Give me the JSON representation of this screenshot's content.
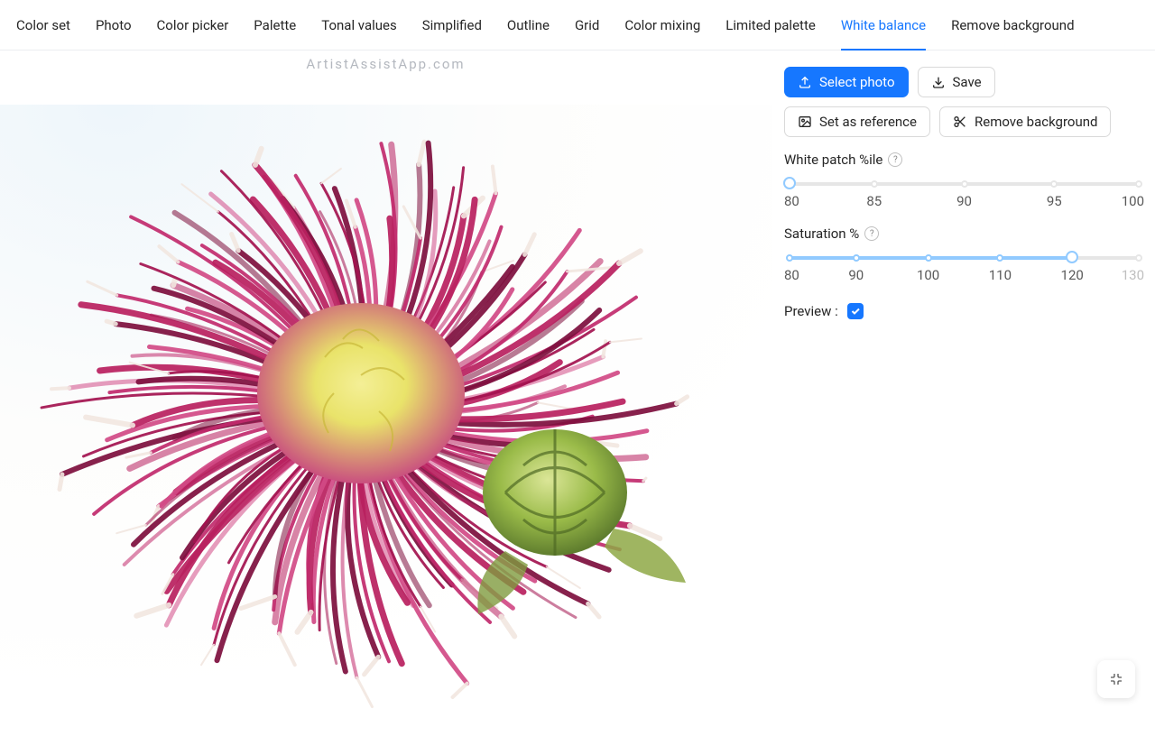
{
  "tabs": {
    "items": [
      {
        "label": "Color set"
      },
      {
        "label": "Photo"
      },
      {
        "label": "Color picker"
      },
      {
        "label": "Palette"
      },
      {
        "label": "Tonal values"
      },
      {
        "label": "Simplified"
      },
      {
        "label": "Outline"
      },
      {
        "label": "Grid"
      },
      {
        "label": "Color mixing"
      },
      {
        "label": "Limited palette"
      },
      {
        "label": "White balance"
      },
      {
        "label": "Remove background"
      }
    ],
    "activeIndex": 10
  },
  "watermark": "ArtistAssistApp.com",
  "buttons": {
    "selectPhoto": "Select photo",
    "save": "Save",
    "setRef": "Set as reference",
    "removeBg": "Remove background"
  },
  "whitePatch": {
    "label": "White patch %ile",
    "min": 80,
    "max": 100,
    "value": 80,
    "marks": [
      "80",
      "85",
      "90",
      "95",
      "100"
    ]
  },
  "saturation": {
    "label": "Saturation %",
    "min": 80,
    "max": 130,
    "value": 120,
    "marks": [
      "80",
      "90",
      "100",
      "110",
      "120",
      "130"
    ]
  },
  "preview": {
    "label": "Preview :",
    "checked": true
  }
}
